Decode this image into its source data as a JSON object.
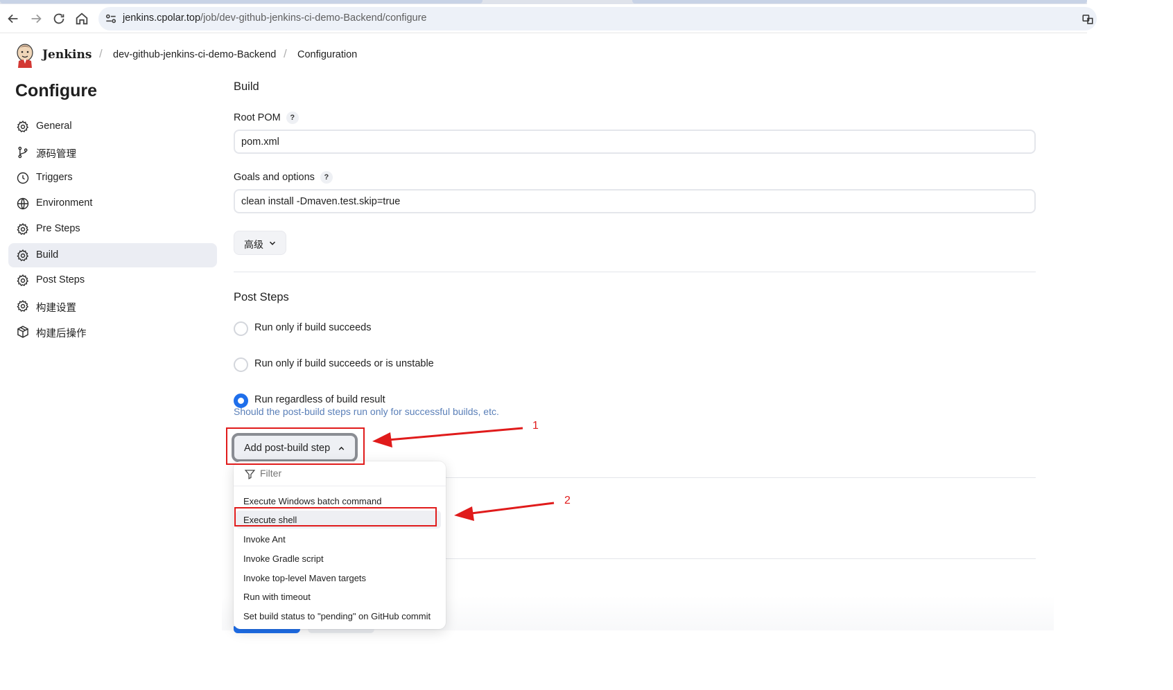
{
  "browser": {
    "url_host": "jenkins.cpolar.top",
    "url_path": "/job/dev-github-jenkins-ci-demo-Backend/configure"
  },
  "header": {
    "brand": "Jenkins",
    "breadcrumbs": [
      "dev-github-jenkins-ci-demo-Backend",
      "Configuration"
    ]
  },
  "sidebar": {
    "title": "Configure",
    "items": [
      {
        "label": "General",
        "icon": "gear-icon"
      },
      {
        "label": "源码管理",
        "icon": "branch-icon"
      },
      {
        "label": "Triggers",
        "icon": "clock-icon"
      },
      {
        "label": "Environment",
        "icon": "globe-icon"
      },
      {
        "label": "Pre Steps",
        "icon": "gear-icon"
      },
      {
        "label": "Build",
        "icon": "gear-icon",
        "active": true
      },
      {
        "label": "Post Steps",
        "icon": "gear-icon"
      },
      {
        "label": "构建设置",
        "icon": "gear-icon"
      },
      {
        "label": "构建后操作",
        "icon": "package-icon"
      }
    ]
  },
  "build": {
    "title": "Build",
    "root_pom_label": "Root POM",
    "root_pom_value": "pom.xml",
    "goals_label": "Goals and options",
    "goals_value": "clean install -Dmaven.test.skip=true",
    "advanced_label": "高级",
    "help_glyph": "?"
  },
  "post_steps": {
    "title": "Post Steps",
    "options": [
      {
        "label": "Run only if build succeeds",
        "checked": false
      },
      {
        "label": "Run only if build succeeds or is unstable",
        "checked": false
      },
      {
        "label": "Run regardless of build result",
        "checked": true
      }
    ],
    "help_text": "Should the post-build steps run only for successful builds, etc.",
    "add_button_label": "Add post-build step"
  },
  "dropdown": {
    "filter_placeholder": "Filter",
    "items": [
      "Execute Windows batch command",
      "Execute shell",
      "Invoke Ant",
      "Invoke Gradle script",
      "Invoke top-level Maven targets",
      "Run with timeout",
      "Set build status to \"pending\" on GitHub commit"
    ],
    "highlighted_index": 1
  },
  "annotations": {
    "marker_1": "1",
    "marker_2": "2",
    "color": "#e01b1b"
  },
  "colors": {
    "accent": "#1f6feb",
    "active_sidebar": "#ebedf3"
  }
}
